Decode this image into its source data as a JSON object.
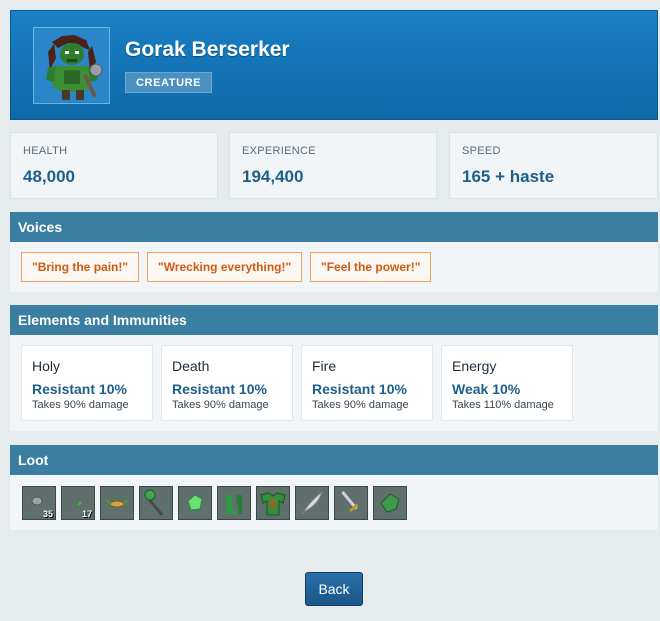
{
  "creature": {
    "name": "Gorak Berserker",
    "type_badge": "CREATURE",
    "portrait_icon": "orc-berserker-icon"
  },
  "stats": [
    {
      "label": "HEALTH",
      "value": "48,000"
    },
    {
      "label": "EXPERIENCE",
      "value": "194,400"
    },
    {
      "label": "SPEED",
      "value": "165 + haste"
    }
  ],
  "voices": {
    "title": "Voices",
    "items": [
      "\"Bring the pain!\"",
      "\"Wrecking everything!\"",
      "\"Feel the power!\""
    ]
  },
  "elements": {
    "title": "Elements and Immunities",
    "items": [
      {
        "name": "Holy",
        "status": "Resistant 10%",
        "damage": "Takes 90% damage"
      },
      {
        "name": "Death",
        "status": "Resistant 10%",
        "damage": "Takes 90% damage"
      },
      {
        "name": "Fire",
        "status": "Resistant 10%",
        "damage": "Takes 90% damage"
      },
      {
        "name": "Energy",
        "status": "Weak 10%",
        "damage": "Takes 110% damage"
      }
    ]
  },
  "loot": {
    "title": "Loot",
    "items": [
      {
        "icon": "small-stone-icon",
        "count": "35"
      },
      {
        "icon": "green-herb-icon",
        "count": "17"
      },
      {
        "icon": "winged-amulet-icon",
        "count": ""
      },
      {
        "icon": "green-mace-icon",
        "count": ""
      },
      {
        "icon": "green-gem-icon",
        "count": ""
      },
      {
        "icon": "green-boots-icon",
        "count": ""
      },
      {
        "icon": "green-armor-icon",
        "count": ""
      },
      {
        "icon": "feather-icon",
        "count": ""
      },
      {
        "icon": "sword-icon",
        "count": ""
      },
      {
        "icon": "leaf-icon",
        "count": ""
      }
    ]
  },
  "back_button": {
    "label": "Back"
  },
  "colors": {
    "header_blue": "#1a7fc4",
    "section_bar": "#3a7ea1",
    "value_blue": "#1d5f8c",
    "voice_orange": "#d05a10"
  }
}
